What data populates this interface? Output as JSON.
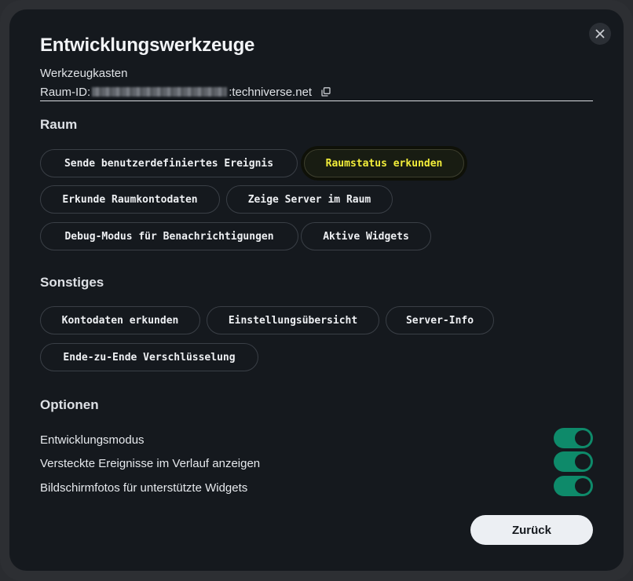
{
  "dialog": {
    "title": "Entwicklungswerkzeuge",
    "subtitle": "Werkzeugkasten",
    "room_id_label": "Raum-ID: ",
    "room_id_server": ":techniverse.net",
    "close_icon": "close-icon",
    "copy_icon": "copy-icon"
  },
  "sections": {
    "room": {
      "heading": "Raum",
      "buttons": [
        "Sende benutzerdefiniertes Ereignis",
        "Raumstatus erkunden",
        "Erkunde Raumkontodaten",
        "Zeige Server im Raum",
        "Debug-Modus für Benachrichtigungen",
        "Aktive Widgets"
      ]
    },
    "other": {
      "heading": "Sonstiges",
      "buttons": [
        "Kontodaten erkunden",
        "Einstellungsübersicht",
        "Server-Info",
        "Ende-zu-Ende Verschlüsselung"
      ]
    },
    "options": {
      "heading": "Optionen",
      "items": [
        {
          "label": "Entwicklungsmodus",
          "enabled": true
        },
        {
          "label": "Versteckte Ereignisse im Verlauf anzeigen",
          "enabled": true
        },
        {
          "label": "Bildschirmfotos für unterstützte Widgets",
          "enabled": true
        }
      ]
    }
  },
  "footer": {
    "back_label": "Zurück"
  },
  "colors": {
    "accent_toggle": "#0e8a6a",
    "highlight_text": "#f3ee3a",
    "background": "#15191e"
  }
}
